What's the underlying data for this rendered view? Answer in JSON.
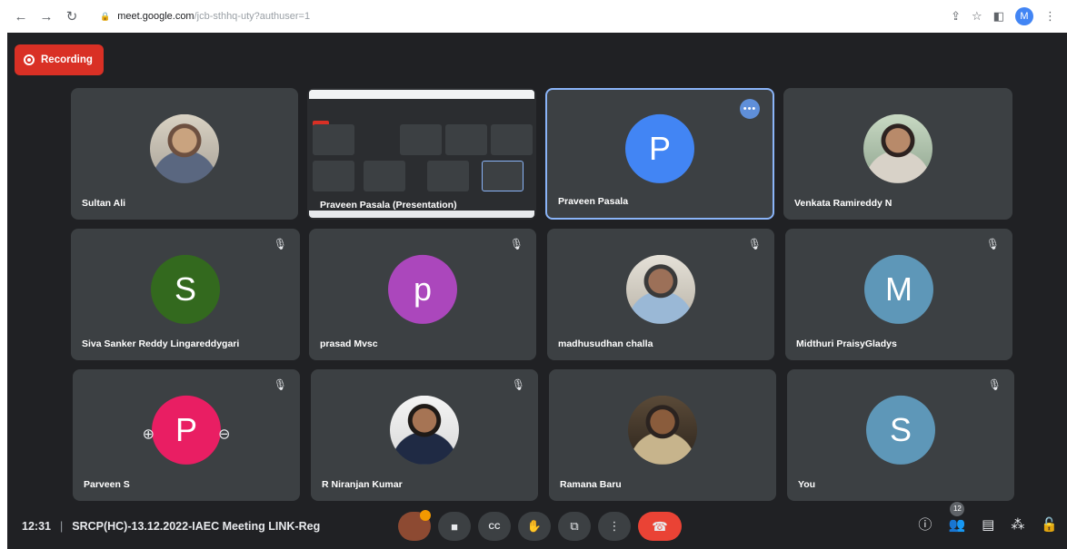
{
  "browser": {
    "url_domain": "meet.google.com",
    "url_path": "/jcb-sthhq-uty?authuser=1",
    "profile_initial": "M"
  },
  "meeting": {
    "recording_label": "Recording",
    "time": "12:31",
    "title": "SRCP(HC)-13.12.2022-IAEC Meeting LINK-Reg",
    "participant_count": "12"
  },
  "tiles": [
    {
      "name": "Sultan Ali",
      "avatar_type": "photo"
    },
    {
      "name": "Praveen Pasala (Presentation)",
      "avatar_type": "presentation"
    },
    {
      "name": "Praveen Pasala",
      "avatar_letter": "P",
      "avatar_color": "#4285f4"
    },
    {
      "name": "Venkata Ramireddy N",
      "avatar_type": "photo"
    },
    {
      "name": "Siva Sanker Reddy Lingareddygari",
      "avatar_letter": "S",
      "avatar_color": "#33691e"
    },
    {
      "name": "prasad Mvsc",
      "avatar_letter": "p",
      "avatar_color": "#ab47bc"
    },
    {
      "name": "madhusudhan challa",
      "avatar_type": "photo"
    },
    {
      "name": "Midthuri PraisyGladys",
      "avatar_letter": "M",
      "avatar_color": "#5e97b8"
    },
    {
      "name": "Parveen S",
      "avatar_letter": "P",
      "avatar_color": "#e91e63"
    },
    {
      "name": "R Niranjan Kumar",
      "avatar_type": "photo"
    },
    {
      "name": "Ramana Baru",
      "avatar_type": "photo"
    },
    {
      "name": "You",
      "avatar_letter": "S",
      "avatar_color": "#5e97b8"
    }
  ],
  "icons": {
    "back": "←",
    "forward": "→",
    "reload": "↻",
    "lock": "🔒",
    "mic_off": "🎙",
    "more": "•••",
    "pin": "⊕",
    "remove": "⊖",
    "camera": "■",
    "captions": "CC",
    "raise_hand": "✋",
    "present": "⧉",
    "more_vert": "⋮",
    "end_call": "☎",
    "info": "ⓘ",
    "people": "👥",
    "chat": "▤",
    "activities": "⁂",
    "lock_host": "🔓"
  }
}
